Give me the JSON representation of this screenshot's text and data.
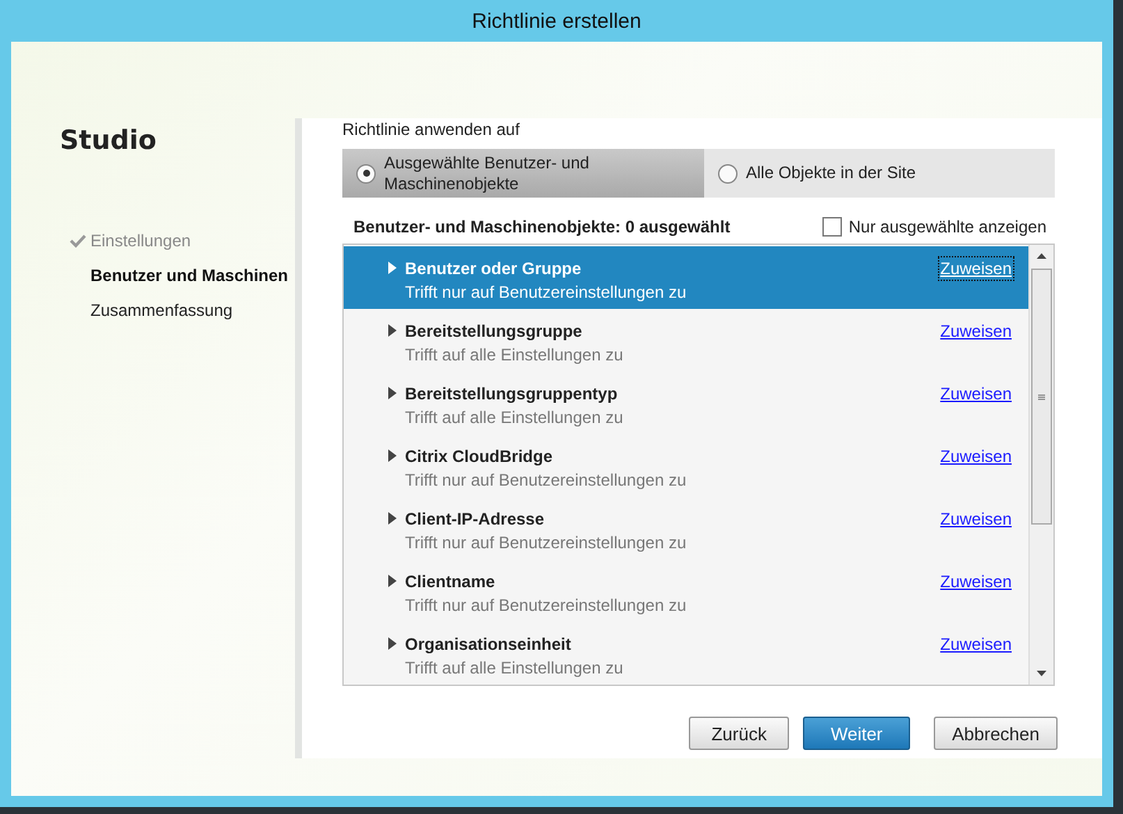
{
  "window": {
    "title": "Richtlinie erstellen"
  },
  "sidebar": {
    "title": "Studio",
    "steps": [
      {
        "label": "Einstellungen",
        "completed": true,
        "selected": false
      },
      {
        "label": "Benutzer und Maschinen",
        "completed": false,
        "selected": true
      },
      {
        "label": "Zusammenfassung",
        "completed": false,
        "selected": false
      }
    ]
  },
  "apply_to": {
    "label": "Richtlinie anwenden auf",
    "options": [
      {
        "label": "Ausgewählte Benutzer- und Maschinenobjekte",
        "selected": true
      },
      {
        "label": "Alle Objekte in der Site",
        "selected": false
      }
    ]
  },
  "objects": {
    "heading": "Benutzer- und Maschinenobjekte: 0 ausgewählt",
    "filter": {
      "label": "Nur ausgewählte anzeigen",
      "checked": false
    },
    "rows": [
      {
        "name": "Benutzer oder Gruppe",
        "description": "Trifft nur auf Benutzereinstellungen zu",
        "action": "Zuweisen",
        "selected": true
      },
      {
        "name": "Bereitstellungsgruppe",
        "description": "Trifft auf alle Einstellungen zu",
        "action": "Zuweisen",
        "selected": false
      },
      {
        "name": "Bereitstellungsgruppentyp",
        "description": "Trifft auf alle Einstellungen zu",
        "action": "Zuweisen",
        "selected": false
      },
      {
        "name": "Citrix CloudBridge",
        "description": "Trifft nur auf Benutzereinstellungen zu",
        "action": "Zuweisen",
        "selected": false
      },
      {
        "name": "Client-IP-Adresse",
        "description": "Trifft nur auf Benutzereinstellungen zu",
        "action": "Zuweisen",
        "selected": false
      },
      {
        "name": "Clientname",
        "description": "Trifft nur auf Benutzereinstellungen zu",
        "action": "Zuweisen",
        "selected": false
      },
      {
        "name": "Organisationseinheit",
        "description": "Trifft auf alle Einstellungen zu",
        "action": "Zuweisen",
        "selected": false
      }
    ]
  },
  "buttons": [
    {
      "label": "Zurück",
      "kind": "secondary"
    },
    {
      "label": "Weiter",
      "kind": "primary"
    },
    {
      "label": "Abbrechen",
      "kind": "secondary"
    }
  ]
}
